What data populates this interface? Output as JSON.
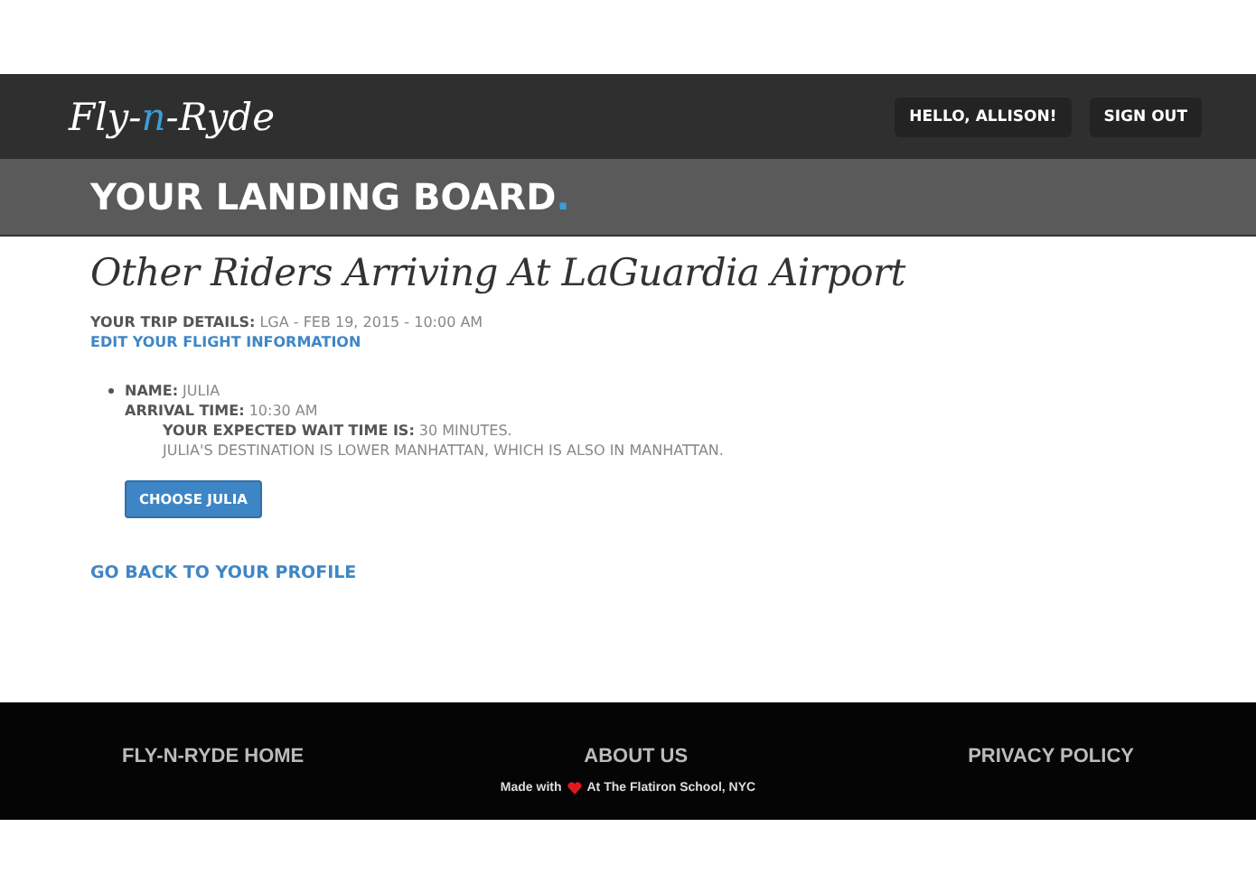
{
  "navbar": {
    "logo": [
      {
        "text": "Fly-",
        "accent": false
      },
      {
        "text": "n",
        "accent": true
      },
      {
        "text": "-Ryde",
        "accent": false
      }
    ],
    "buttons": [
      "HELLO, ALLISON!",
      "SIGN OUT"
    ]
  },
  "banner": {
    "title": [
      {
        "text": "YOUR LANDING BOARD",
        "accent": false
      },
      {
        "text": ".",
        "accent": true
      }
    ]
  },
  "content": {
    "heading": "Other Riders Arriving At LaGuardia Airport",
    "trip_details": "**YOUR TRIP DETAILS:** LGA - FEB 19, 2015 - 10:00 AM",
    "edit_link": "EDIT YOUR FLIGHT INFORMATION",
    "riders": [
      {
        "name": "**NAME:** JULIA",
        "arrival": "**ARRIVAL TIME:** 10:30 AM",
        "wait": "**YOUR EXPECTED WAIT TIME IS:** 30 MINUTES.",
        "destination": "JULIA'S DESTINATION IS LOWER MANHATTAN, WHICH IS ALSO IN MANHATTAN.",
        "button": "CHOOSE JULIA"
      }
    ],
    "back_link": "GO BACK TO YOUR PROFILE"
  },
  "footer": {
    "links": [
      "FLY-N-RYDE HOME",
      "ABOUT US",
      "PRIVACY POLICY"
    ],
    "credit_before": "Made with",
    "credit_after": "At The Flatiron School, NYC"
  }
}
